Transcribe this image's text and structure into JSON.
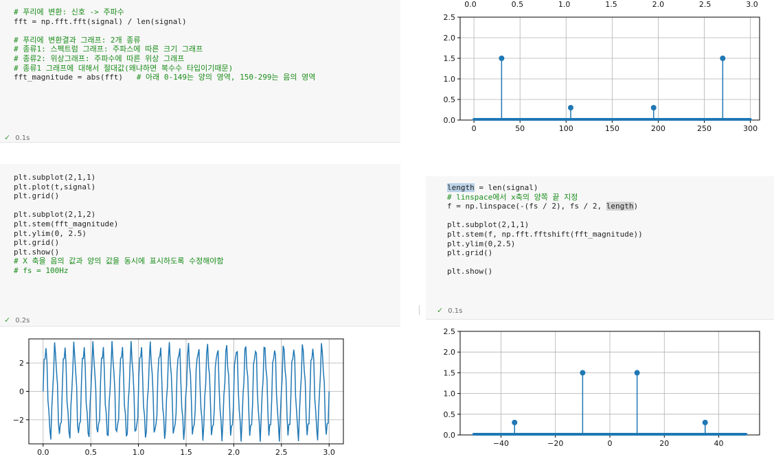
{
  "cells": {
    "fft_cell": {
      "lines": [
        "# 푸리에 변환: 신호 -> 주파수",
        "fft = np.fft.fft(signal) / len(signal)",
        "",
        "# 푸리에 변환결과 그래프: 2개 종류",
        "# 종류1: 스펙트럼 그래프: 주파스에 따른 크기 그래프",
        "# 종류2: 위상그래프: 주파수에 따른 위상 그래프",
        "# 종류1 그래프에 대해서 절대값(왜냐하면 복수수 타입이기때문)",
        "fft_magnitude = abs(fft)   ",
        "# 아래 0-149는 양의 영역, 150-299는 음의 영역"
      ],
      "status": "0.1s"
    },
    "plot_cell": {
      "lines": [
        "plt.subplot(2,1,1)",
        "plt.plot(t,signal)",
        "plt.grid()",
        "",
        "plt.subplot(2,1,2)",
        "plt.stem(fft_magnitude)",
        "plt.ylim(0, 2.5)",
        "plt.grid()",
        "plt.show()",
        "# X 축을 음의 값과 양의 값을 동시에 표시하도록 수정해야함",
        "# fs = 100Hz"
      ],
      "status": "0.2s"
    },
    "shift_cell": {
      "tok_length": "length",
      "tok_rest1": " = len(signal)",
      "line2": "# linspace에서 x축의 양쪽 끝 지정",
      "line3a": "f = np.linspace(-(fs / 2), fs / 2, ",
      "line3b": "length",
      "line3c": ")",
      "line5": "plt.subplot(2,1,1)",
      "line6": "plt.stem(f, np.fft.fftshift(fft_magnitude))",
      "line7": "plt.ylim(0,2.5)",
      "line8": "plt.grid()",
      "line10": "plt.show()",
      "status": "0.1s"
    }
  },
  "chart_data": [
    {
      "type": "scatter",
      "title": "",
      "xlabel": "",
      "ylabel": "",
      "xlim": [
        -15,
        310
      ],
      "ylim": [
        0,
        2.5
      ],
      "x_ticks": [
        "0",
        "50",
        "100",
        "150",
        "200",
        "250",
        "300"
      ],
      "y_ticks": [
        "0.0",
        "0.5",
        "1.0",
        "1.5",
        "2.0",
        "2.5"
      ],
      "top_ticks": [
        "0.0",
        "0.5",
        "1.0",
        "1.5",
        "2.0",
        "2.5",
        "3.0"
      ],
      "stems": [
        {
          "x": 30,
          "y": 1.5
        },
        {
          "x": 105,
          "y": 0.3
        },
        {
          "x": 195,
          "y": 0.3
        },
        {
          "x": 270,
          "y": 1.5
        }
      ],
      "baseline": [
        0,
        300
      ],
      "grid": true,
      "color": "#1f77b4"
    },
    {
      "type": "line",
      "title": "",
      "xlabel": "",
      "ylabel": "",
      "xlim": [
        -0.15,
        3.15
      ],
      "ylim": [
        -3.7,
        3.7
      ],
      "x_ticks": [
        "0.0",
        "0.5",
        "1.0",
        "1.5",
        "2.0",
        "2.5",
        "3.0"
      ],
      "y_ticks": [
        "2",
        "0",
        "−2"
      ],
      "series": [
        {
          "formula": "3*sin(2*pi*10*t) + 0.6*sin(2*pi*35*t)",
          "t_range": [
            0,
            3
          ],
          "samples": 300
        }
      ],
      "grid": true,
      "color": "#1f77b4"
    },
    {
      "type": "scatter",
      "title": "",
      "xlabel": "",
      "ylabel": "",
      "xlim": [
        -55,
        55
      ],
      "ylim": [
        0,
        2.5
      ],
      "x_ticks": [
        "−40",
        "−20",
        "0",
        "20",
        "40"
      ],
      "y_ticks": [
        "0.0",
        "0.5",
        "1.0",
        "1.5",
        "2.0",
        "2.5"
      ],
      "stems": [
        {
          "x": -35,
          "y": 0.3
        },
        {
          "x": -10,
          "y": 1.5
        },
        {
          "x": 10,
          "y": 1.5
        },
        {
          "x": 35,
          "y": 0.3
        }
      ],
      "baseline": [
        -50,
        50
      ],
      "grid": true,
      "color": "#1f77b4"
    }
  ]
}
